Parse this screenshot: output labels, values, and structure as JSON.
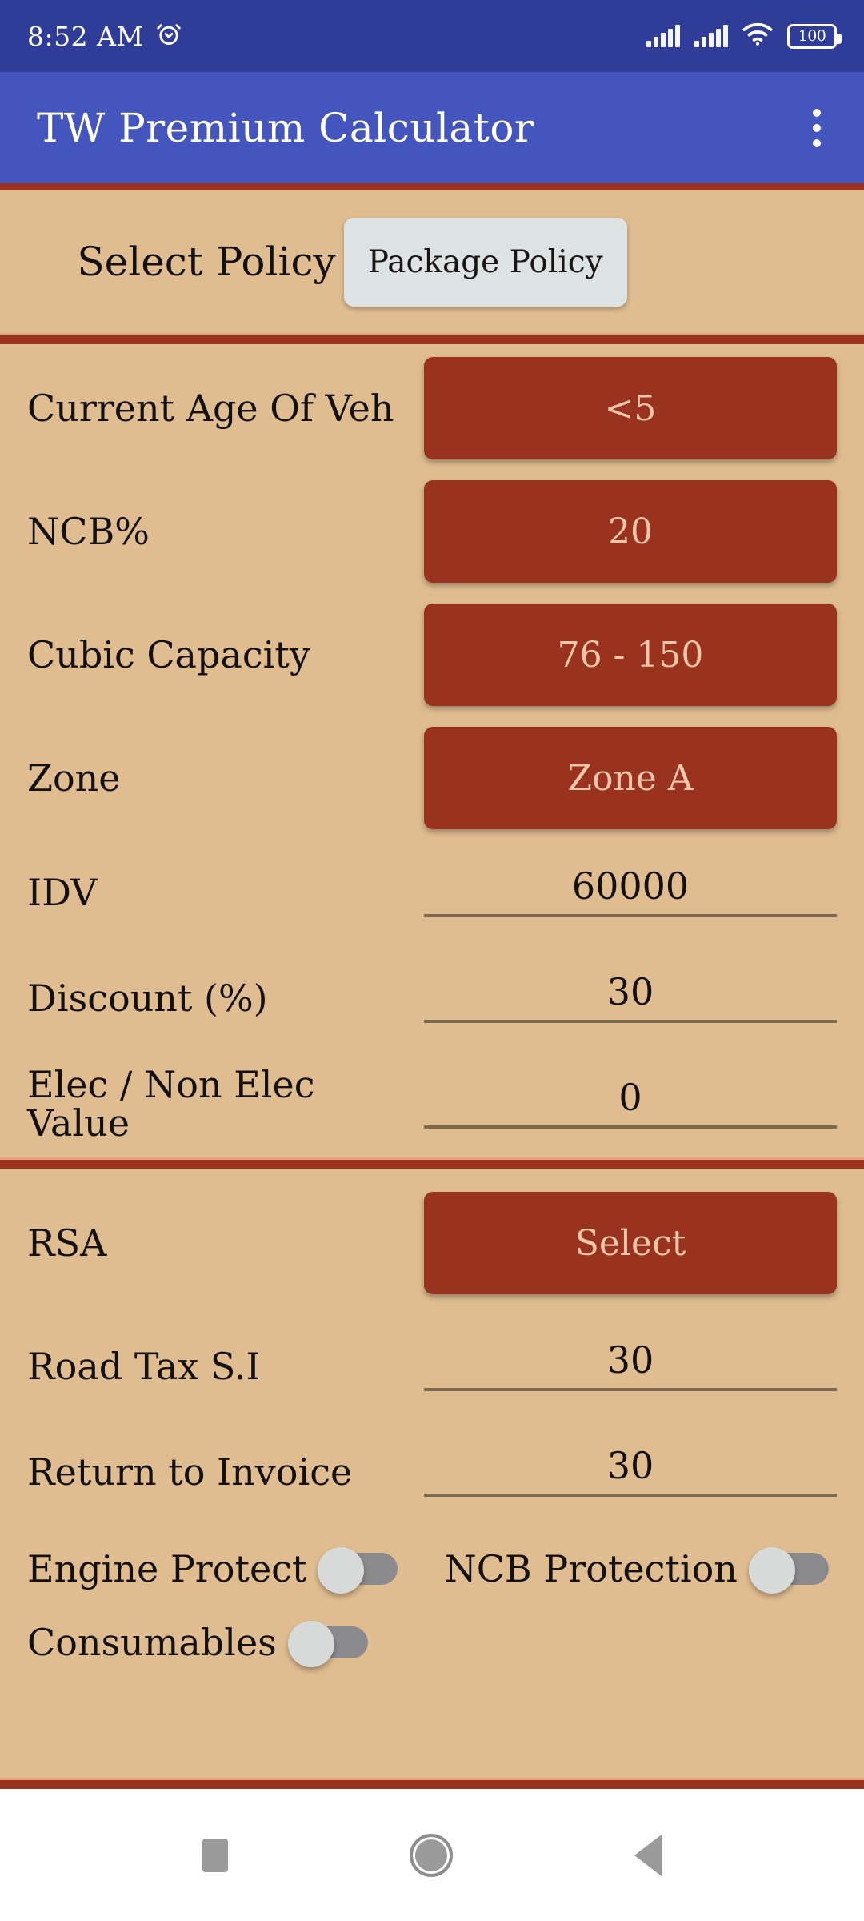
{
  "statusbar": {
    "time": "8:52 AM",
    "alarm_icon": "alarm-icon",
    "battery_level": "100"
  },
  "appbar": {
    "title": "TW Premium Calculator",
    "overflow_icon": "overflow-menu-icon"
  },
  "policy": {
    "label": "Select Policy",
    "selected": "Package Policy"
  },
  "form": {
    "rows": [
      {
        "label": "Current Age Of Veh",
        "value": "<5",
        "type": "dropdown"
      },
      {
        "label": "NCB%",
        "value": "20",
        "type": "dropdown"
      },
      {
        "label": "Cubic Capacity",
        "value": "76 - 150",
        "type": "dropdown"
      },
      {
        "label": "Zone",
        "value": "Zone A",
        "type": "dropdown"
      },
      {
        "label": "IDV",
        "value": "60000",
        "type": "input"
      },
      {
        "label": "Discount (%)",
        "value": "30",
        "type": "input"
      },
      {
        "label": "Elec / Non Elec Value",
        "value": "0",
        "type": "input"
      }
    ]
  },
  "addons": {
    "rows": [
      {
        "label": "RSA",
        "value": "Select",
        "type": "dropdown"
      },
      {
        "label": "Road Tax S.I",
        "value": "30",
        "type": "input"
      },
      {
        "label": "Return to Invoice",
        "value": "30",
        "type": "input"
      }
    ],
    "toggles": [
      {
        "label": "Engine Protect",
        "state": "off"
      },
      {
        "label": "NCB Protection",
        "state": "off"
      },
      {
        "label": "Consumables",
        "state": "off"
      }
    ]
  },
  "navbar": {
    "recents_icon": "square-recents-icon",
    "home_icon": "circle-home-icon",
    "back_icon": "triangle-back-icon"
  },
  "colors": {
    "statusbar": "#2f3d99",
    "appbar": "#4455bd",
    "background": "#e0bd91",
    "accent_red": "#9a3220",
    "button_text": "#f2c7a9",
    "policy_button": "#dde2e2"
  }
}
